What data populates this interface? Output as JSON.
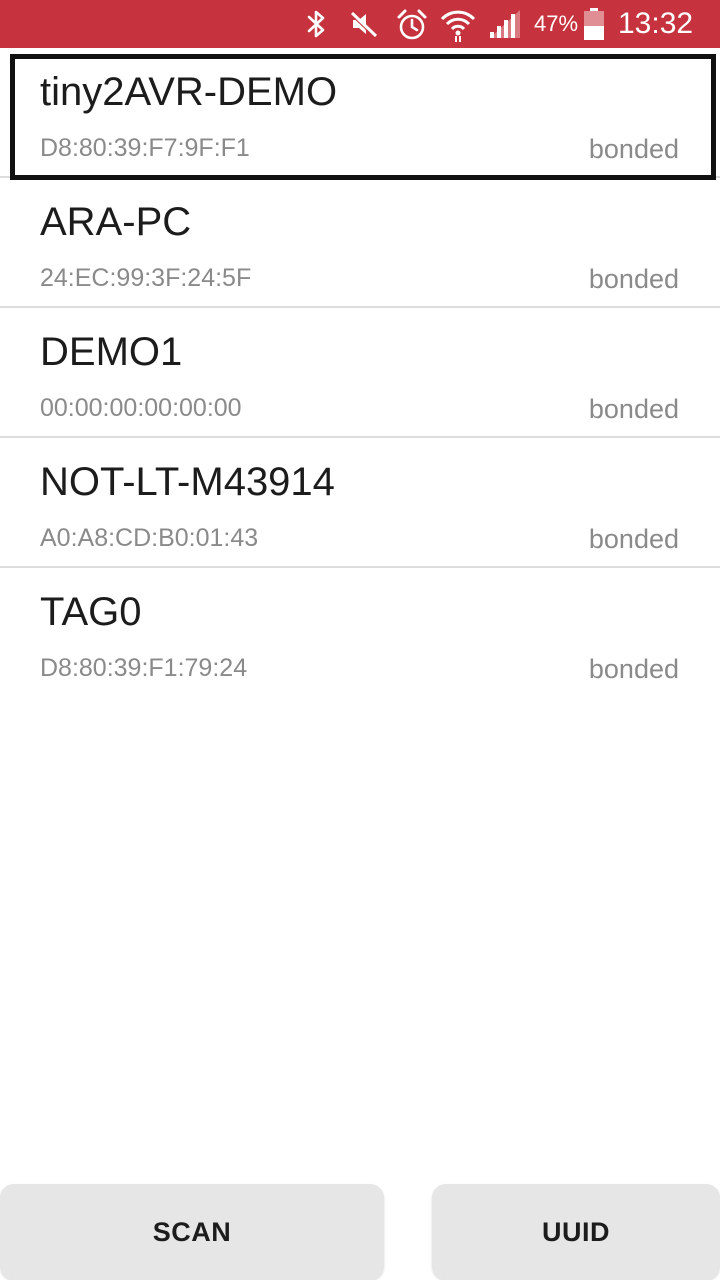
{
  "status_bar": {
    "color": "#c6323d",
    "icons": [
      "bluetooth-icon",
      "mute-icon",
      "alarm-icon",
      "wifi-icon",
      "signal-icon",
      "battery-icon"
    ],
    "battery_percent": "47%",
    "time": "13:32"
  },
  "devices": [
    {
      "name": "tiny2AVR-DEMO",
      "address": "D8:80:39:F7:9F:F1",
      "state": "bonded",
      "selected": true
    },
    {
      "name": "ARA-PC",
      "address": "24:EC:99:3F:24:5F",
      "state": "bonded"
    },
    {
      "name": "DEMO1",
      "address": "00:00:00:00:00:00",
      "state": "bonded"
    },
    {
      "name": "NOT-LT-M43914",
      "address": "A0:A8:CD:B0:01:43",
      "state": "bonded"
    },
    {
      "name": "TAG0",
      "address": "D8:80:39:F1:79:24",
      "state": "bonded"
    }
  ],
  "buttons": {
    "scan_label": "SCAN",
    "uuid_label": "UUID"
  }
}
